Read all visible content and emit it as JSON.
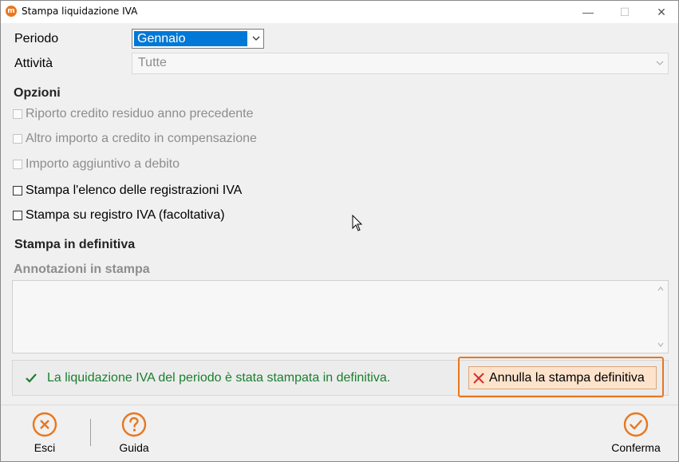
{
  "window": {
    "title": "Stampa liquidazione IVA",
    "app_icon_glyph": "m",
    "minimize_glyph": "—",
    "maximize_glyph": "☐",
    "close_glyph": "✕"
  },
  "form": {
    "periodo_label": "Periodo",
    "periodo_value": "Gennaio",
    "attivita_label": "Attività",
    "attivita_value": "Tutte"
  },
  "options": {
    "heading": "Opzioni",
    "items": [
      {
        "label": "Riporto credito residuo anno precedente",
        "checked": false,
        "enabled": false
      },
      {
        "label": "Altro importo a credito in compensazione",
        "checked": false,
        "enabled": false
      },
      {
        "label": "Importo aggiuntivo a debito",
        "checked": false,
        "enabled": false
      },
      {
        "label": "Stampa l'elenco delle registrazioni IVA",
        "checked": false,
        "enabled": true
      },
      {
        "label": "Stampa su registro IVA (facoltativa)",
        "checked": false,
        "enabled": true
      }
    ]
  },
  "definitiva": {
    "heading": "Stampa in definitiva",
    "annotations_label": "Annotazioni in stampa",
    "annotations_value": "",
    "status_text": "La liquidazione IVA del periodo è stata stampata in definitiva.",
    "annulla_label": "Annulla la stampa definitiva"
  },
  "footer": {
    "esci_label": "Esci",
    "guida_label": "Guida",
    "conferma_label": "Conferma"
  },
  "colors": {
    "accent": "#e8771f",
    "selection": "#0078d7",
    "success": "#1a7f2e",
    "danger": "#d32f2f"
  }
}
